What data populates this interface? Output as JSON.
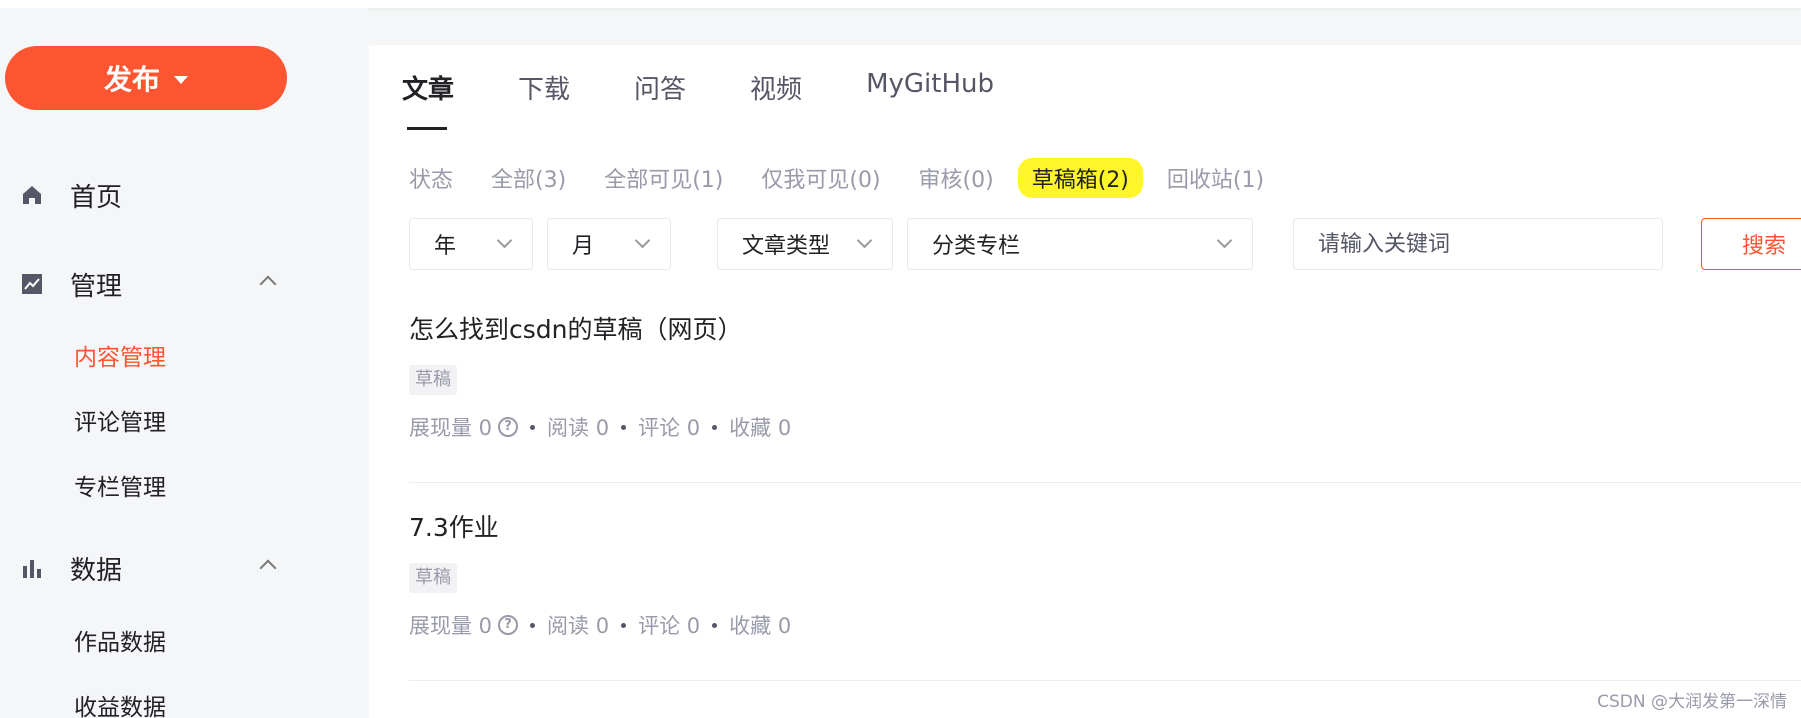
{
  "sidebar": {
    "publish_label": "发布",
    "groups": [
      {
        "label": "首页",
        "icon": "home-icon"
      },
      {
        "label": "管理",
        "icon": "chart-line-icon"
      },
      {
        "label": "数据",
        "icon": "bar-chart-icon"
      }
    ],
    "manage_items": [
      "内容管理",
      "评论管理",
      "专栏管理"
    ],
    "data_items": [
      "作品数据",
      "收益数据"
    ]
  },
  "tabs": [
    "文章",
    "下载",
    "问答",
    "视频",
    "MyGitHub"
  ],
  "status": {
    "label": "状态",
    "items": [
      "全部(3)",
      "全部可见(1)",
      "仅我可见(0)",
      "审核(0)",
      "草稿箱(2)",
      "回收站(1)"
    ]
  },
  "filters": {
    "year": "年",
    "month": "月",
    "article_type": "文章类型",
    "category": "分类专栏",
    "search_placeholder": "请输入关键词",
    "search_label": "搜索"
  },
  "articles": [
    {
      "title": "怎么找到csdn的草稿（网页）",
      "tag": "草稿",
      "views": "展现量 0",
      "reads": "阅读 0",
      "comments": "评论 0",
      "favorites": "收藏 0"
    },
    {
      "title": "7.3作业",
      "tag": "草稿",
      "views": "展现量 0",
      "reads": "阅读 0",
      "comments": "评论 0",
      "favorites": "收藏 0"
    }
  ],
  "watermark": "CSDN @大润发第一深情",
  "colors": {
    "accent": "#fc5531",
    "highlight": "#fff62a"
  }
}
